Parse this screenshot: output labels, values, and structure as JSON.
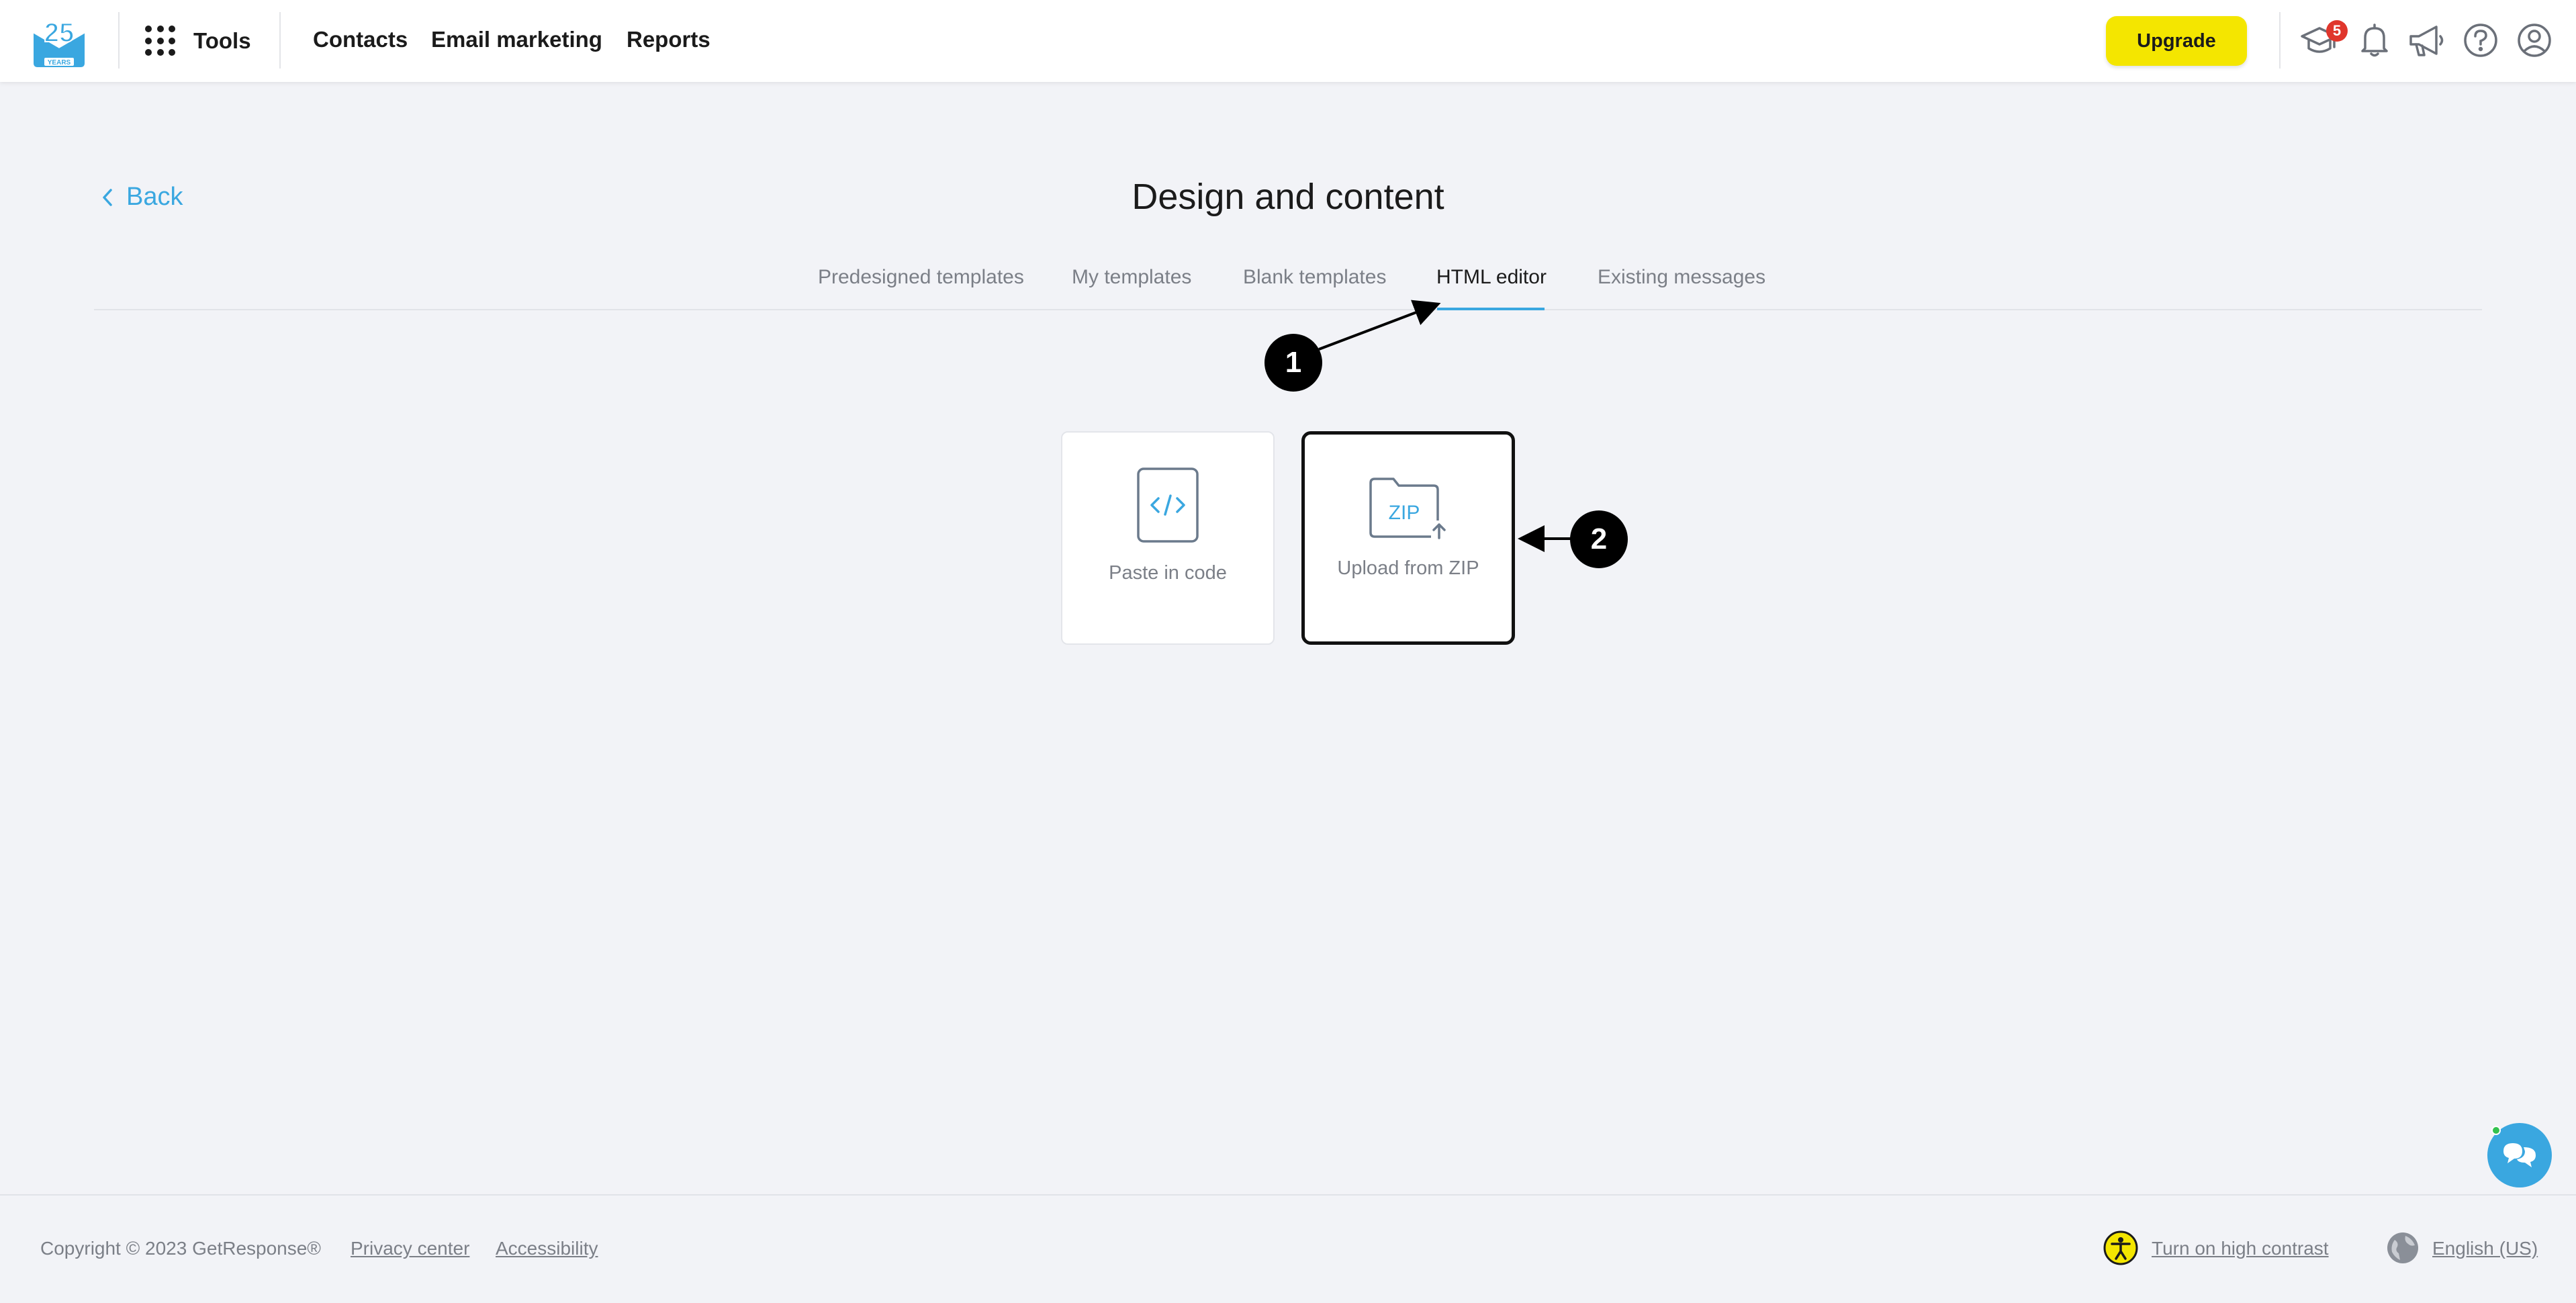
{
  "header": {
    "logo_label": "25 YEARS",
    "tools_label": "Tools",
    "nav": [
      "Contacts",
      "Email marketing",
      "Reports"
    ],
    "upgrade_label": "Upgrade",
    "notification_badge": "5",
    "icons": [
      "graduation-cap-icon",
      "bell-icon",
      "megaphone-icon",
      "help-icon",
      "user-icon"
    ]
  },
  "page": {
    "back_label": "Back",
    "title": "Design and content",
    "tabs": [
      {
        "label": "Predesigned templates",
        "active": false
      },
      {
        "label": "My templates",
        "active": false
      },
      {
        "label": "Blank templates",
        "active": false
      },
      {
        "label": "HTML editor",
        "active": true
      },
      {
        "label": "Existing messages",
        "active": false
      }
    ]
  },
  "options": [
    {
      "label": "Paste in code",
      "icon": "code-icon",
      "selected": false
    },
    {
      "label": "Upload from ZIP",
      "icon_text": "ZIP",
      "icon": "zip-folder-icon",
      "selected": true
    }
  ],
  "callouts": [
    "1",
    "2"
  ],
  "footer": {
    "copyright": "Copyright © 2023 GetResponse®",
    "privacy": "Privacy center",
    "accessibility": "Accessibility",
    "contrast": "Turn on high contrast",
    "language": "English (US)"
  },
  "colors": {
    "accent": "#3aa7e0",
    "upgrade": "#f4e600",
    "badge": "#e0362c",
    "background": "#f2f3f7"
  }
}
